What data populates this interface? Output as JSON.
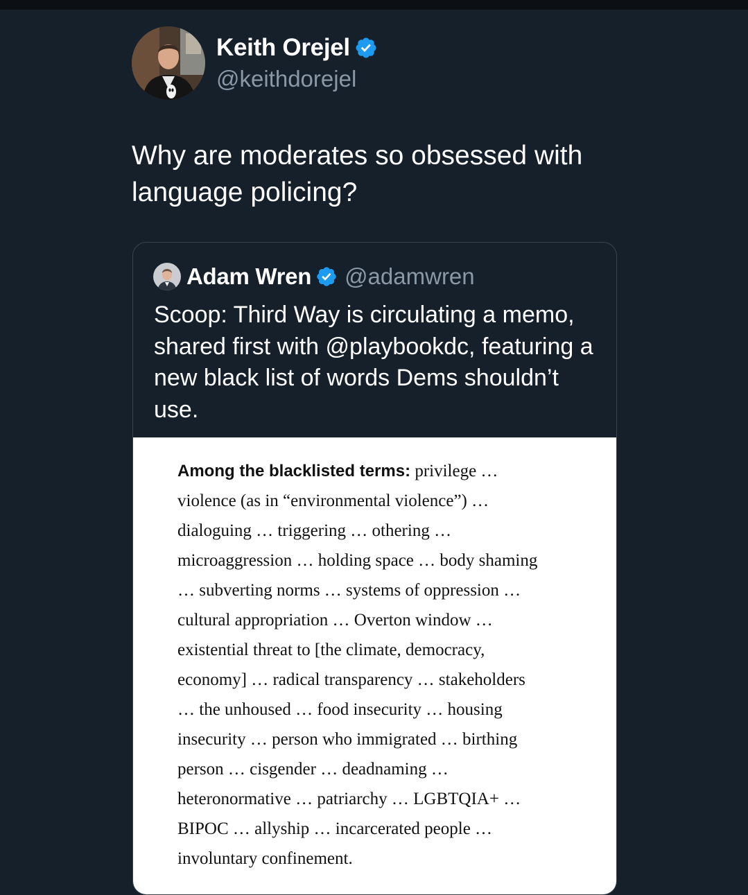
{
  "tweet": {
    "author": {
      "display_name": "Keith Orejel",
      "handle": "@keithdorejel",
      "verified": true
    },
    "text": "Why are moderates so obsessed with language policing?"
  },
  "quoted_tweet": {
    "author": {
      "display_name": "Adam Wren",
      "handle": "@adamwren",
      "verified": true
    },
    "text": "Scoop: Third Way is circulating a memo, shared first with @playbookdc, featuring a new black list of words Dems shouldn’t use.",
    "image": {
      "lead": "Among the blacklisted terms:",
      "lines": [
        " privilege …",
        "violence (as in “environmental violence”) …",
        "dialoguing … triggering … othering …",
        "microaggression … holding space … body shaming",
        "… subverting norms … systems of oppression …",
        "cultural appropriation … Overton window …",
        "existential threat to [the climate, democracy,",
        "economy] … radical transparency … stakeholders",
        "… the unhoused … food insecurity … housing",
        "insecurity … person who immigrated … birthing",
        "person … cisgender … deadnaming …",
        "heteronormative … patriarchy … LGBTQIA+ …",
        "BIPOC … allyship … incarcerated people …",
        "involuntary confinement."
      ]
    }
  },
  "colors": {
    "background": "#15202b",
    "text_primary": "#ffffff",
    "text_secondary": "#8b98a5",
    "verified_badge": "#1d9bf0",
    "card_border": "#38444d",
    "memo_background": "#ffffff",
    "memo_text": "#111111"
  },
  "icons": {
    "verified": "verified-badge-icon",
    "avatar_main": "user-avatar",
    "avatar_quoted": "user-avatar"
  }
}
